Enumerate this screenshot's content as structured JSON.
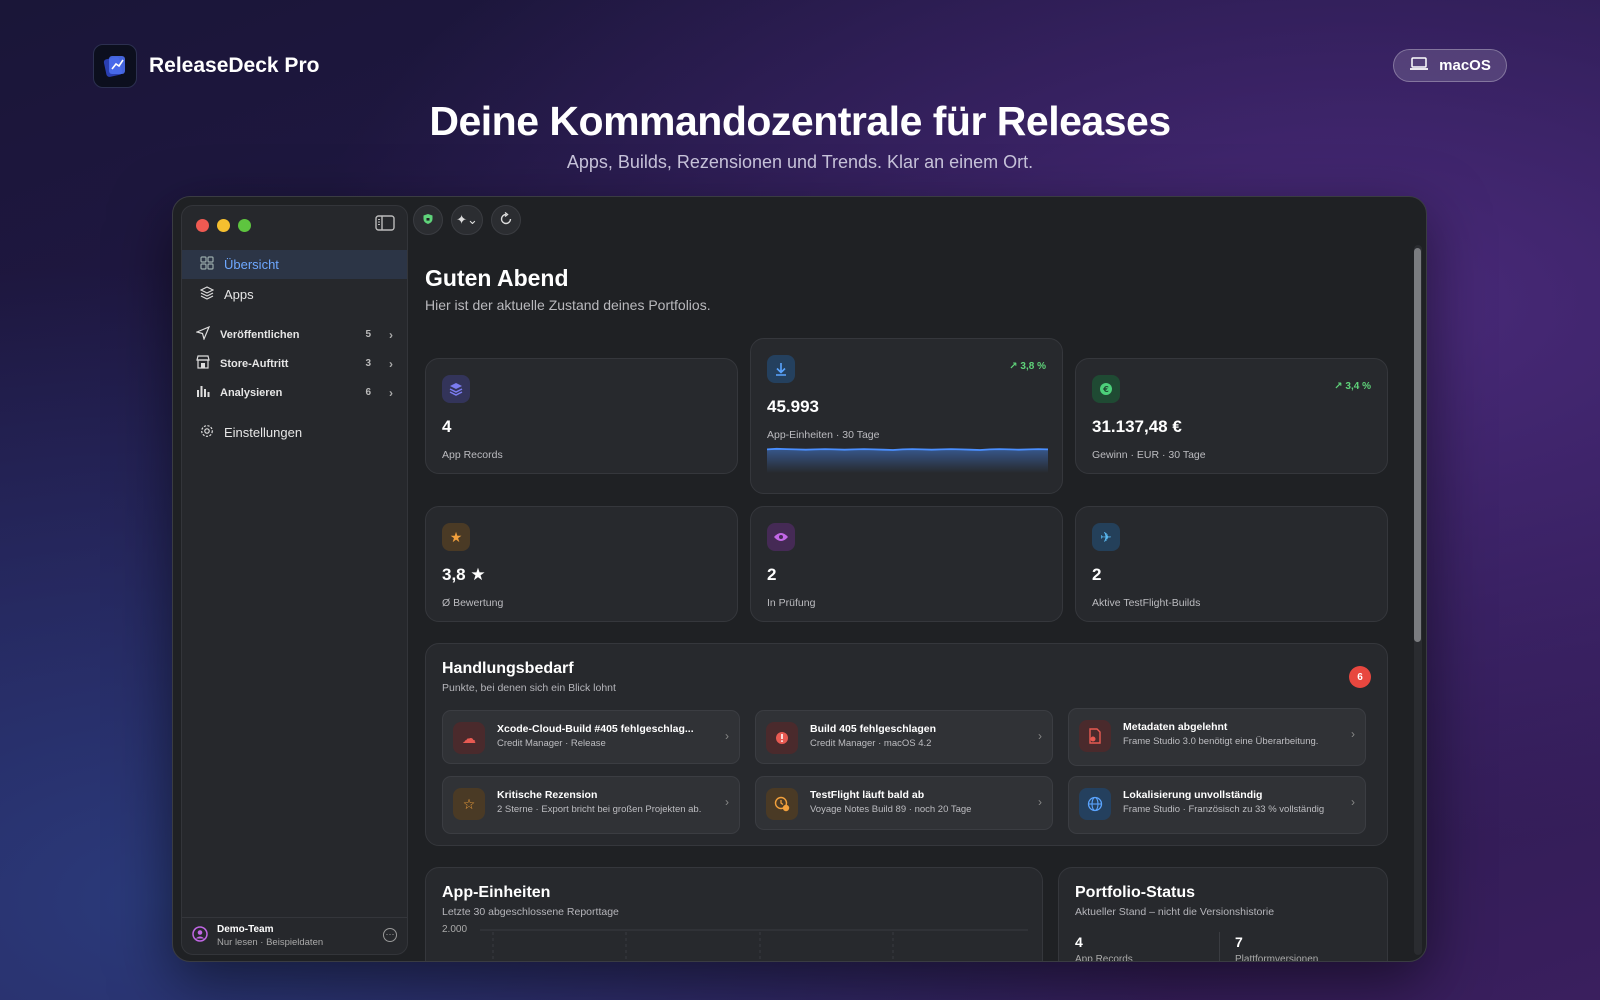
{
  "brand": {
    "name": "ReleaseDeck Pro"
  },
  "platform": {
    "label": "macOS"
  },
  "hero": {
    "title": "Deine Kommandozentrale für Releases",
    "subtitle": "Apps, Builds, Rezensionen und Trends. Klar an einem Ort."
  },
  "sidebar": {
    "items": [
      {
        "label": "Übersicht",
        "icon": "grid-icon",
        "active": true
      },
      {
        "label": "Apps",
        "icon": "layers-icon"
      }
    ],
    "groups": [
      {
        "label": "Veröffentlichen",
        "count": "5",
        "icon": "paper-plane-icon"
      },
      {
        "label": "Store-Auftritt",
        "count": "3",
        "icon": "storefront-icon"
      },
      {
        "label": "Analysieren",
        "count": "6",
        "icon": "bar-chart-icon"
      }
    ],
    "settings": {
      "label": "Einstellungen",
      "icon": "gear-icon"
    },
    "team": {
      "name": "Demo-Team",
      "status": "Nur lesen · Beispieldaten"
    }
  },
  "main": {
    "greeting": "Guten Abend",
    "subtitle": "Hier ist der aktuelle Zustand deines Portfolios."
  },
  "kpis": [
    {
      "value": "4",
      "label": "App Records",
      "icon": "stack-icon",
      "color": "#7b7cf0"
    },
    {
      "value": "45.993",
      "label": "App-Einheiten · 30 Tage",
      "trend": "3,8 %",
      "icon": "download-icon",
      "color": "#5aa4ff"
    },
    {
      "value": "31.137,48 €",
      "label": "Gewinn · EUR · 30 Tage",
      "trend": "3,4 %",
      "icon": "euro-icon",
      "color": "#4cd07a"
    },
    {
      "value": "3,8 ★",
      "label": "Ø Bewertung",
      "icon": "star-icon",
      "color": "#f2a03c"
    },
    {
      "value": "2",
      "label": "In Prüfung",
      "icon": "eye-icon",
      "color": "#c267e6"
    },
    {
      "value": "2",
      "label": "Aktive TestFlight-Builds",
      "icon": "airplane-icon",
      "color": "#5ab8f0"
    }
  ],
  "sparkline": {
    "values": [
      0.72,
      0.74,
      0.73,
      0.72,
      0.71,
      0.72,
      0.73,
      0.72,
      0.71,
      0.72,
      0.73,
      0.72,
      0.71,
      0.7,
      0.72,
      0.73,
      0.72,
      0.71,
      0.72,
      0.73,
      0.72,
      0.71,
      0.7,
      0.72,
      0.73,
      0.72,
      0.71,
      0.72,
      0.73,
      0.72
    ],
    "color": "#4a8fff"
  },
  "action": {
    "title": "Handlungsbedarf",
    "subtitle": "Punkte, bei denen sich ein Blick lohnt",
    "count": "6",
    "items": [
      {
        "title": "Xcode-Cloud-Build #405 fehlgeschlag...",
        "sub": "Credit Manager · Release",
        "icon": "cloud-error-icon",
        "color": "#e85a52"
      },
      {
        "title": "Build 405 fehlgeschlagen",
        "sub": "Credit Manager · macOS 4.2",
        "icon": "error-icon",
        "color": "#e85a52"
      },
      {
        "title": "Metadaten abgelehnt",
        "sub": "Frame Studio 3.0 benötigt eine Überarbeitung.",
        "icon": "document-error-icon",
        "color": "#e85a52"
      },
      {
        "title": "Kritische Rezension",
        "sub": "2 Sterne · Export bricht bei großen Projekten ab.",
        "icon": "half-star-icon",
        "color": "#f2a03c"
      },
      {
        "title": "TestFlight läuft bald ab",
        "sub": "Voyage Notes Build 89 · noch 20 Tage",
        "icon": "clock-warning-icon",
        "color": "#f2a03c"
      },
      {
        "title": "Lokalisierung unvollständig",
        "sub": "Frame Studio · Französisch zu 33 % vollständig",
        "icon": "globe-icon",
        "color": "#5aa4ff"
      }
    ]
  },
  "units_chart": {
    "title": "App-Einheiten",
    "subtitle": "Letzte 30 abgeschlossene Reporttage",
    "ytick": "2.000"
  },
  "portfolio": {
    "title": "Portfolio-Status",
    "subtitle": "Aktueller Stand – nicht die Versionshistorie",
    "stats": [
      {
        "value": "4",
        "label": "App Records"
      },
      {
        "value": "7",
        "label": "Plattformversionen"
      }
    ]
  }
}
